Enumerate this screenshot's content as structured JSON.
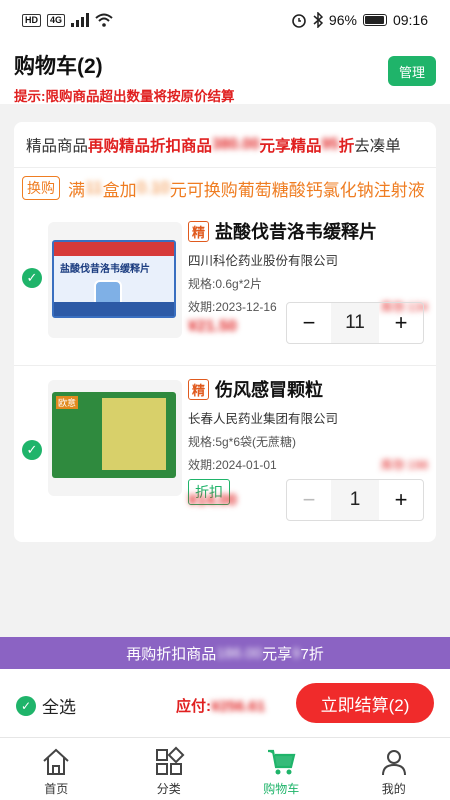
{
  "status_bar": {
    "left_tags": [
      "HD",
      "4G"
    ],
    "battery": "96%",
    "time": "09:16"
  },
  "header": {
    "title": "购物车(2)",
    "tip": "提示:限购商品超出数量将按原价结算",
    "manage_label": "管理"
  },
  "promo": {
    "prefix": "精品商品",
    "red_text": "再购精品折扣商品",
    "blur_amount": "380.00",
    "mid_text": "元享精品",
    "blur_rate": "95",
    "suffix_red": "折",
    "suffix": "去凑单"
  },
  "swap": {
    "tag": "换购",
    "text_a": "满",
    "blur_a": "11",
    "text_b": "盒加",
    "blur_b": "0.10",
    "text_c": "元可换购葡萄糖酸钙氯化钠注射液"
  },
  "items": [
    {
      "badge": "精",
      "name": "盐酸伐昔洛韦缓释片",
      "maker": "四川科伦药业股份有限公司",
      "spec": "规格:0.6g*2片",
      "expiry": "效期:2023-12-16",
      "stock": "库存:134",
      "price": "¥21.50",
      "qty": "11",
      "minus": "−",
      "plus": "+"
    },
    {
      "badge": "精",
      "name": "伤风感冒颗粒",
      "maker": "长春人民药业集团有限公司",
      "spec": "规格:5g*6袋(无蔗糖)",
      "expiry": "效期:2024-01-01",
      "stock": "库存:198",
      "tag": "折扣",
      "price": "¥14.00",
      "qty": "1",
      "minus": "−",
      "plus": "+"
    }
  ],
  "discount_bar": {
    "text_a": "再购折扣商品",
    "blur_amount": "186.00",
    "text_b": "元享",
    "blur_rate": "9",
    "text_c": "7折"
  },
  "bottom": {
    "select_all": "全选",
    "total_label": "应付:",
    "total_value": "¥256.61",
    "checkout": "立即结算(2)"
  },
  "tabs": [
    {
      "label": "首页",
      "icon": "home-icon"
    },
    {
      "label": "分类",
      "icon": "category-icon"
    },
    {
      "label": "购物车",
      "icon": "cart-icon"
    },
    {
      "label": "我的",
      "icon": "user-icon"
    }
  ],
  "colors": {
    "brand_green": "#1fb46a",
    "accent_red": "#e02020",
    "purple": "#8b63c3",
    "orange": "#ef7d22"
  }
}
